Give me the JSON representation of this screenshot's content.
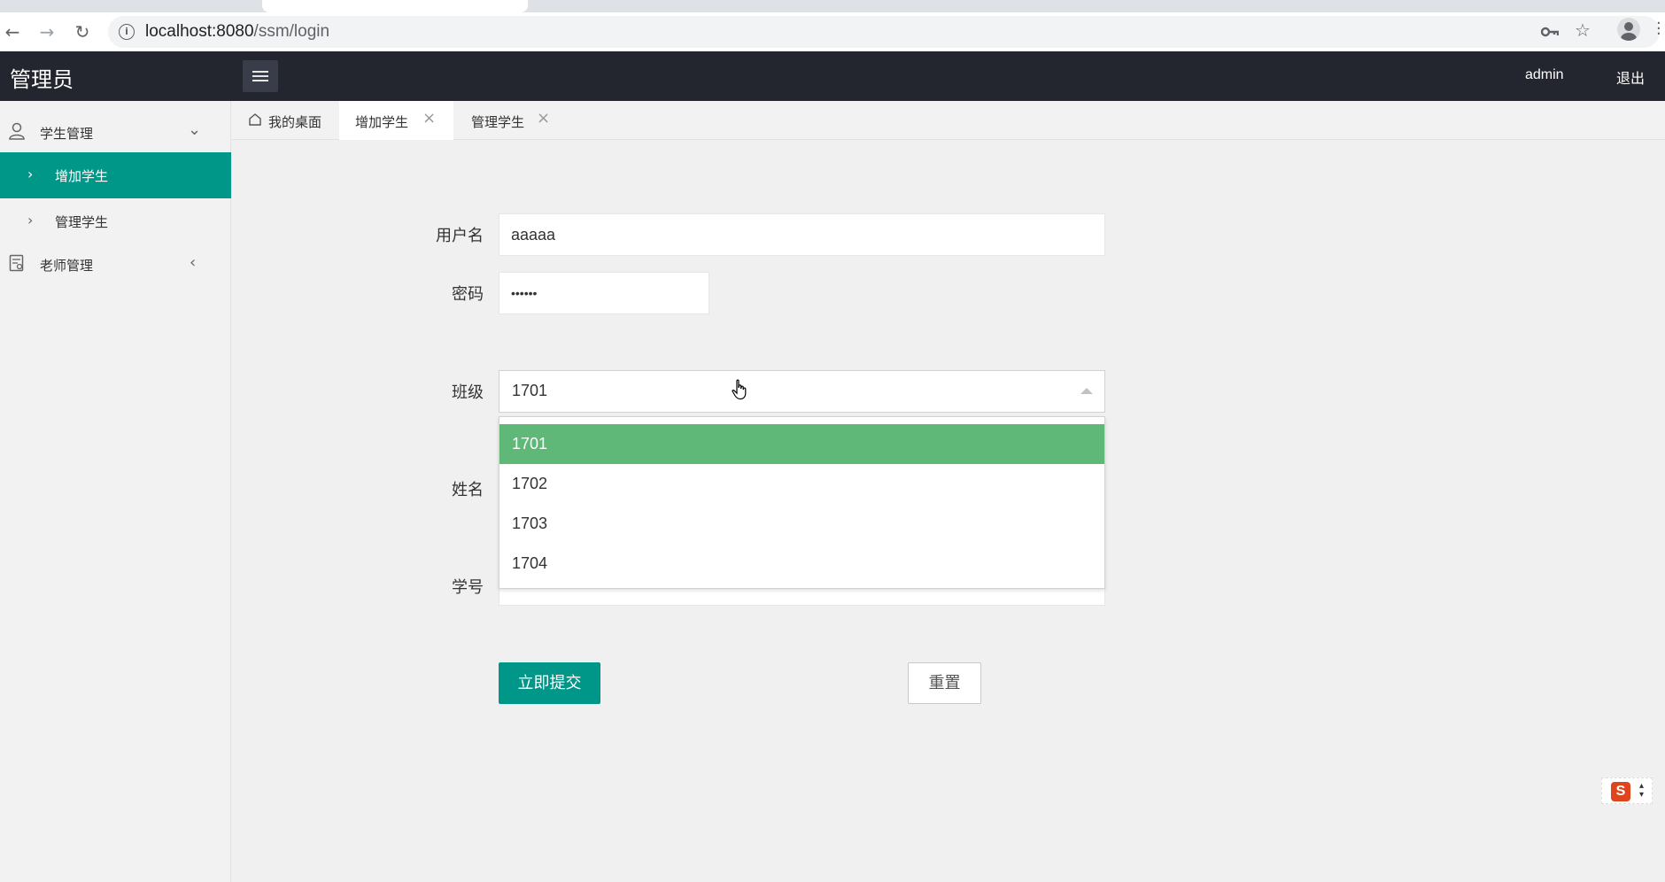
{
  "browser": {
    "url_host": "localhost:8080",
    "url_path": "/ssm/login"
  },
  "header": {
    "title": "管理员",
    "user": "admin",
    "logout": "退出"
  },
  "sidebar": {
    "groups": [
      {
        "label": "学生管理",
        "items": [
          {
            "label": "增加学生",
            "active": true
          },
          {
            "label": "管理学生",
            "active": false
          }
        ]
      },
      {
        "label": "老师管理",
        "items": []
      }
    ]
  },
  "tabs": [
    {
      "label": "我的桌面",
      "closable": false
    },
    {
      "label": "增加学生",
      "closable": true
    },
    {
      "label": "管理学生",
      "closable": true
    }
  ],
  "form": {
    "username_label": "用户名",
    "username_value": "aaaaa",
    "password_label": "密码",
    "password_value": "••••••",
    "class_label": "班级",
    "class_value": "1701",
    "class_options": [
      "1701",
      "1702",
      "1703",
      "1704"
    ],
    "name_label": "姓名",
    "studentno_label": "学号",
    "submit": "立即提交",
    "reset": "重置"
  },
  "colors": {
    "primary": "#009688",
    "selected_option": "#5fb878",
    "header_bg": "#23262e"
  },
  "ime_widget": {
    "logo": "S"
  }
}
